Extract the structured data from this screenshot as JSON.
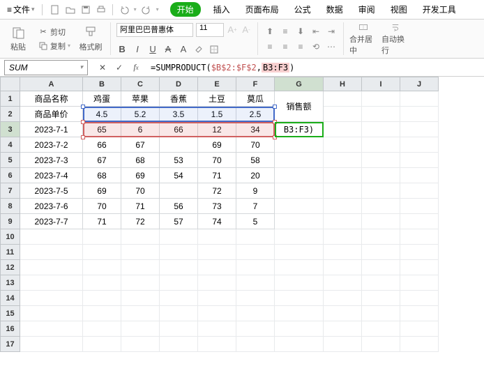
{
  "menu": {
    "file": "文件",
    "tabs": [
      "开始",
      "插入",
      "页面布局",
      "公式",
      "数据",
      "审阅",
      "视图",
      "开发工具"
    ]
  },
  "ribbon": {
    "paste": "粘贴",
    "cut": "剪切",
    "copy": "复制",
    "formatpainter": "格式刷",
    "font_name": "阿里巴巴普惠体",
    "font_size": "11",
    "merge": "合并居中",
    "wrap": "自动换行"
  },
  "fx": {
    "namebox": "SUM",
    "formula_prefix": "=SUMPRODUCT(",
    "formula_arg1": "$B$2:$F$2",
    "formula_sep": ",",
    "formula_arg2": "B3:F3",
    "formula_suffix": ")"
  },
  "columns": [
    "A",
    "B",
    "C",
    "D",
    "E",
    "F",
    "G",
    "H",
    "I",
    "J"
  ],
  "g2_label": "销售额",
  "g3_display": "B3:F3)",
  "chart_data": {
    "type": "table",
    "headers_row1": [
      "商品名称",
      "鸡蛋",
      "苹果",
      "香蕉",
      "土豆",
      "莫瓜"
    ],
    "headers_row2_label": "商品单价",
    "unit_price": [
      4.5,
      5.2,
      3.5,
      1.5,
      2.5
    ],
    "dates": [
      "2023-7-1",
      "2023-7-2",
      "2023-7-3",
      "2023-7-4",
      "2023-7-5",
      "2023-7-6",
      "2023-7-7"
    ],
    "values": [
      [
        65,
        6,
        66,
        12,
        34
      ],
      [
        66,
        67,
        null,
        69,
        70
      ],
      [
        67,
        68,
        53,
        70,
        58
      ],
      [
        68,
        69,
        54,
        71,
        20
      ],
      [
        69,
        70,
        null,
        72,
        9
      ],
      [
        70,
        71,
        56,
        73,
        7
      ],
      [
        71,
        72,
        57,
        74,
        5
      ]
    ]
  }
}
